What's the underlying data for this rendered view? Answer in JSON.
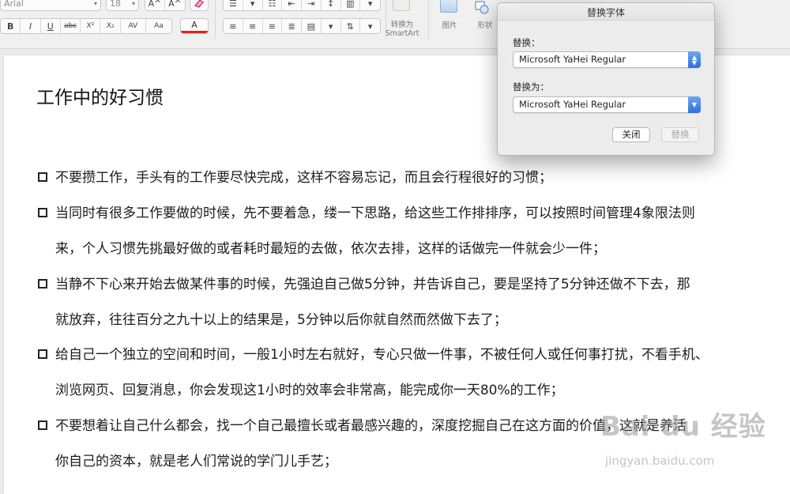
{
  "ribbon": {
    "font_name": "Arial",
    "font_size": "18",
    "format_buttons": [
      "B",
      "I",
      "U",
      "abc",
      "X²",
      "X₂",
      "AV",
      "Aa"
    ],
    "grow_font": "A^",
    "shrink_font": "A^",
    "font_color": "A",
    "smartart_label_line1": "转换为",
    "smartart_label_line2": "SmartArt",
    "picture_label": "图片",
    "shape_label": "形状"
  },
  "document": {
    "title": "工作中的好习惯",
    "items": [
      {
        "line1": "不要攒工作，手头有的工作要尽快完成，这样不容易忘记，而且会行程很好的习惯；",
        "line2": ""
      },
      {
        "line1": "当同时有很多工作要做的时候，先不要着急，缕一下思路，给这些工作排排序，可以按照时间管理4象限法则",
        "line2": "来，个人习惯先挑最好做的或者耗时最短的去做，依次去排，这样的话做完一件就会少一件；"
      },
      {
        "line1": "当静不下心来开始去做某件事的时候，先强迫自己做5分钟，并告诉自己，要是坚持了5分钟还做不下去，那",
        "line2": "就放弃，往往百分之九十以上的结果是，5分钟以后你就自然而然做下去了；"
      },
      {
        "line1": "给自己一个独立的空间和时间，一般1小时左右就好，专心只做一件事，不被任何人或任何事打扰，不看手机、",
        "line2": "浏览网页、回复消息，你会发现这1小时的效率会非常高，能完成你一天80%的工作；"
      },
      {
        "line1": "不要想着让自己什么都会，找一个自己最擅长或者最感兴趣的，深度挖掘自己在这方面的价值，这就是养活",
        "line2": "你自己的资本，就是老人们常说的学门儿手艺；"
      }
    ]
  },
  "dialog": {
    "title": "替换字体",
    "replace_label": "替换：",
    "replace_value": "Microsoft YaHei Regular",
    "replace_with_label": "替换为：",
    "replace_with_value": "Microsoft YaHei Regular",
    "close_button": "关闭",
    "replace_button": "替换"
  },
  "watermark": {
    "logo": "Bai du 经验",
    "url": "jingyan.baidu.com"
  },
  "colors": {
    "accent_blue": "#2f6fdc",
    "font_color_underline": "#e02020"
  }
}
